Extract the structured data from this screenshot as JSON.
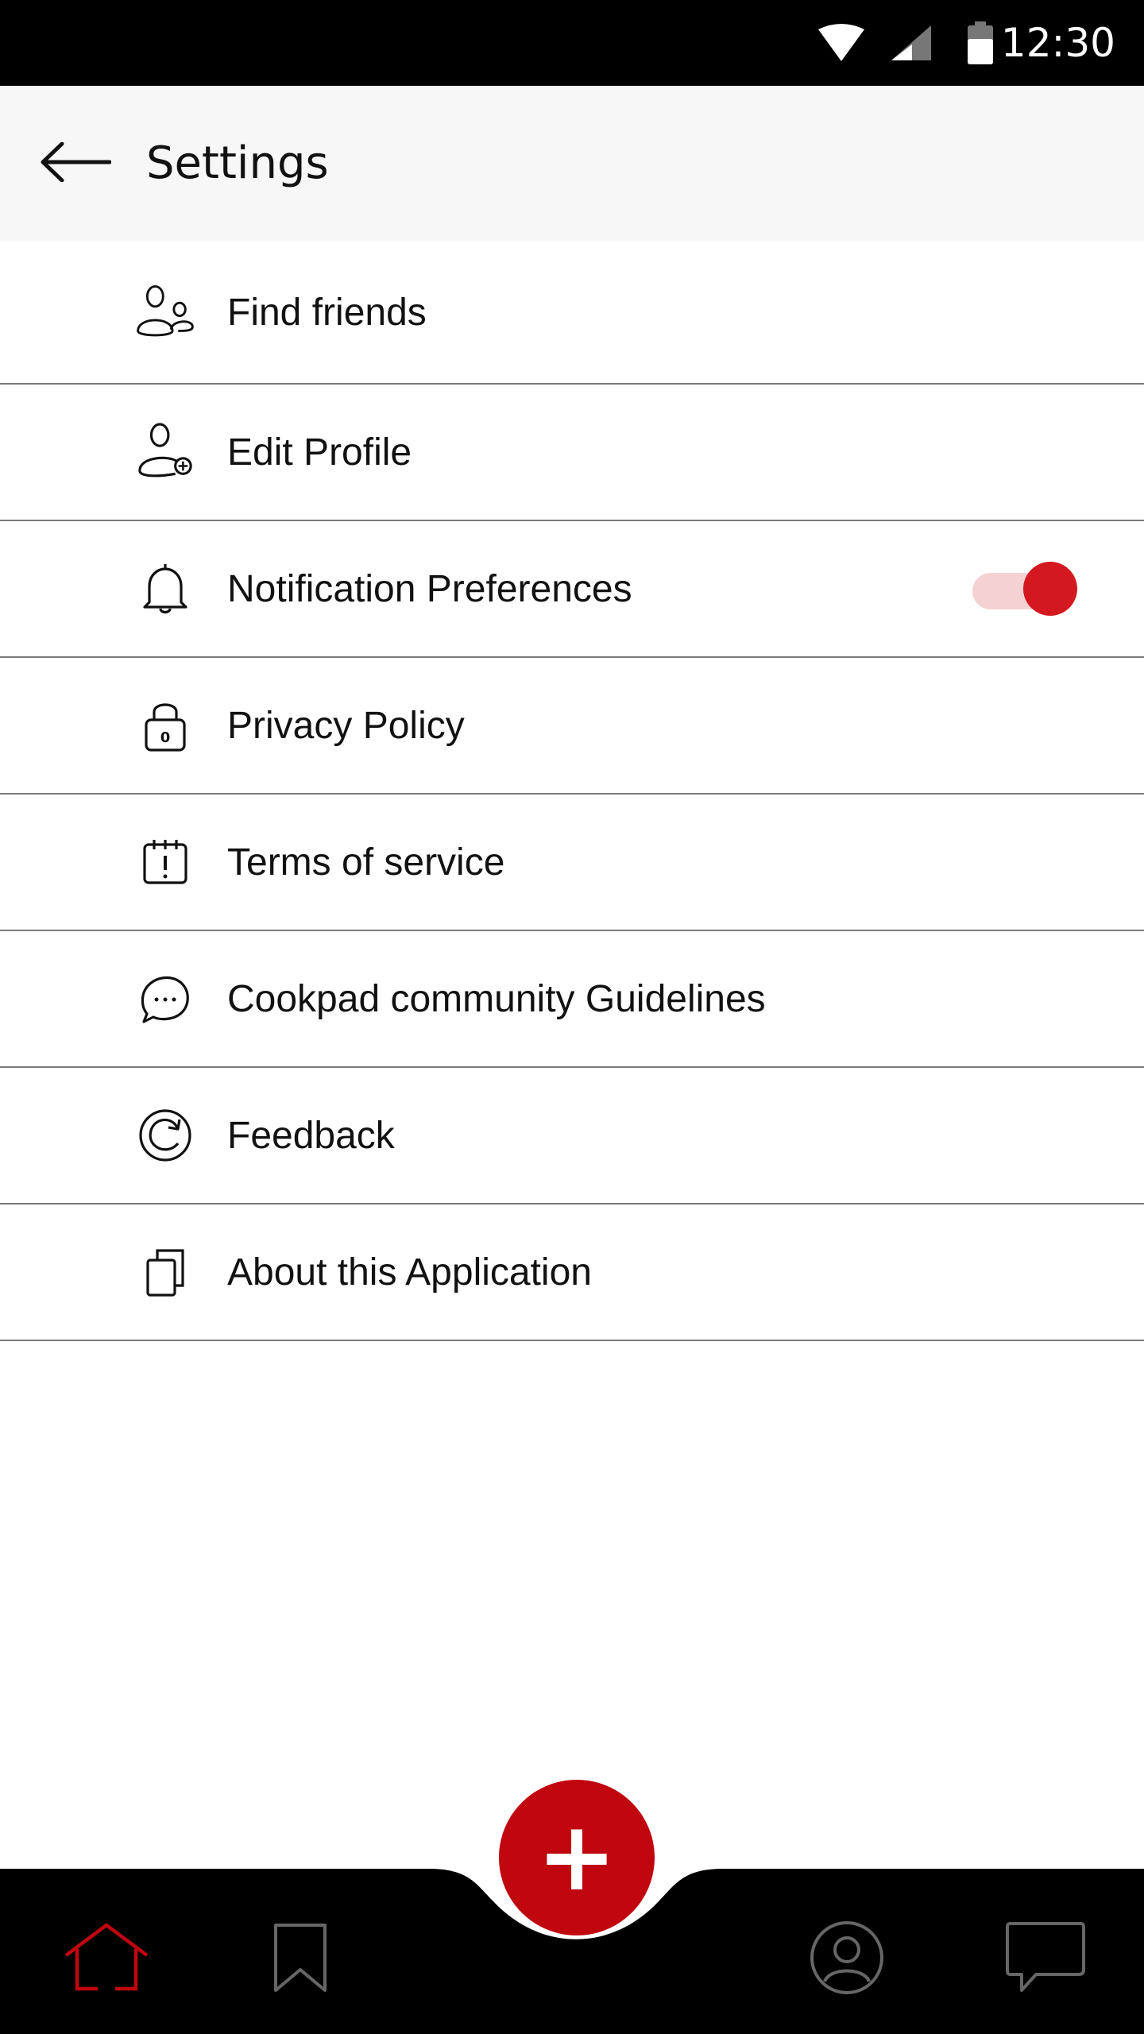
{
  "status_bar": {
    "time": "12:30",
    "icons": [
      "wifi-icon",
      "cell-signal-icon",
      "battery-icon"
    ]
  },
  "app_bar": {
    "title": "Settings",
    "back_icon": "arrow-left-icon"
  },
  "settings": [
    {
      "label": "Find friends",
      "icon": "users-icon"
    },
    {
      "label": "Edit Profile",
      "icon": "user-plus-icon"
    },
    {
      "label": "Notification Preferences",
      "icon": "bell-icon",
      "toggle": true,
      "toggle_on": true
    },
    {
      "label": "Privacy Policy",
      "icon": "lock-icon"
    },
    {
      "label": "Terms of service",
      "icon": "calendar-alert-icon"
    },
    {
      "label": "Cookpad community Guidelines",
      "icon": "chat-bubble-icon"
    },
    {
      "label": "Feedback",
      "icon": "refresh-icon"
    },
    {
      "label": "About this Application",
      "icon": "copy-icon"
    }
  ],
  "bottom_nav": {
    "items": [
      {
        "name": "home",
        "icon": "home-icon",
        "active": true
      },
      {
        "name": "saved",
        "icon": "bookmark-icon",
        "active": false
      },
      {
        "name": "profile",
        "icon": "account-icon",
        "active": false
      },
      {
        "name": "messages",
        "icon": "message-icon",
        "active": false
      }
    ],
    "fab_icon": "plus-icon",
    "fab_label": "+"
  },
  "colors": {
    "accent": "#c0060f",
    "toggle_thumb": "#d4181f",
    "toggle_track": "#f4d2d3",
    "app_bar_bg": "#f7f7f7",
    "nav_bg": "#000000",
    "divider": "#7a7a7a"
  }
}
